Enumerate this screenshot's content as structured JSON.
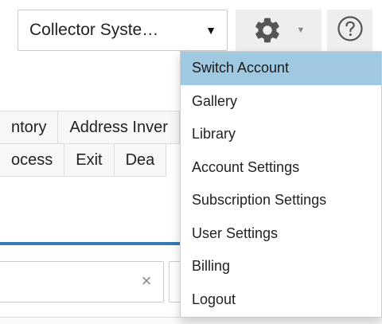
{
  "toolbar": {
    "account_select": {
      "value": "Collector Syste…",
      "caret": "▼"
    },
    "gear_caret": "▼",
    "icons": {
      "settings": "gear-icon",
      "help": "question-circle-icon"
    }
  },
  "tabs": {
    "row1": [
      "ntory",
      "Address Inver"
    ],
    "row2": [
      "ocess",
      "Exit",
      "Dea"
    ]
  },
  "search": {
    "clear": "×"
  },
  "menu": {
    "items": [
      {
        "label": "Switch Account",
        "active": true
      },
      {
        "label": "Gallery"
      },
      {
        "label": "Library"
      },
      {
        "label": "Account Settings"
      },
      {
        "label": "Subscription Settings"
      },
      {
        "label": "User Settings"
      },
      {
        "label": "Billing"
      },
      {
        "label": "Logout"
      }
    ]
  },
  "colors": {
    "active_item": "#9ec9e0",
    "accent_blue": "#337ab7"
  }
}
